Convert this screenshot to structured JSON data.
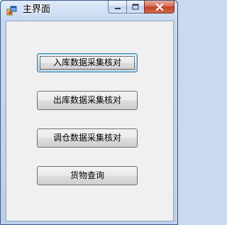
{
  "window": {
    "title": "主界面",
    "icon": "app-window-icon",
    "caption_buttons": [
      "minimize-icon",
      "maximize-icon",
      "close-icon"
    ]
  },
  "buttons": [
    {
      "label": "入库数据采集核对",
      "focused": true
    },
    {
      "label": "出库数据采集核对",
      "focused": false
    },
    {
      "label": "调仓数据采集核对",
      "focused": false
    },
    {
      "label": "货物查询",
      "focused": false
    }
  ],
  "colors": {
    "titlebar": "#c6d8f0",
    "client_bg": "#f0f0f0",
    "close_button": "#c0422a",
    "focus_border": "#3c7fb1"
  }
}
